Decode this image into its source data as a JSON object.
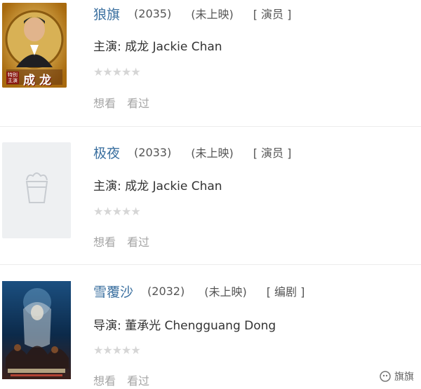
{
  "movies": [
    {
      "title": "狼旗",
      "year": "(2035)",
      "status": "(未上映)",
      "role": "[ 演员 ]",
      "credit": "主演: 成龙 Jackie Chan",
      "poster_text": "成龙",
      "poster_subtext": "特别\n主演",
      "stars": "★★★★★",
      "actions": [
        "想看",
        "看过"
      ]
    },
    {
      "title": "极夜",
      "year": "(2033)",
      "status": "(未上映)",
      "role": "[ 演员 ]",
      "credit": "主演: 成龙 Jackie Chan",
      "stars": "★★★★★",
      "actions": [
        "想看",
        "看过"
      ]
    },
    {
      "title": "雪覆沙",
      "year": "(2032)",
      "status": "(未上映)",
      "role": "[ 编剧 ]",
      "credit": "导演: 董承光 Chengguang Dong",
      "stars": "★★★★★",
      "actions": [
        "想看",
        "看过"
      ]
    }
  ],
  "watermark": "旗旗",
  "colors": {
    "link": "#3a6f9f",
    "star_empty": "#d6d6d6",
    "muted": "#a5a5a5"
  }
}
